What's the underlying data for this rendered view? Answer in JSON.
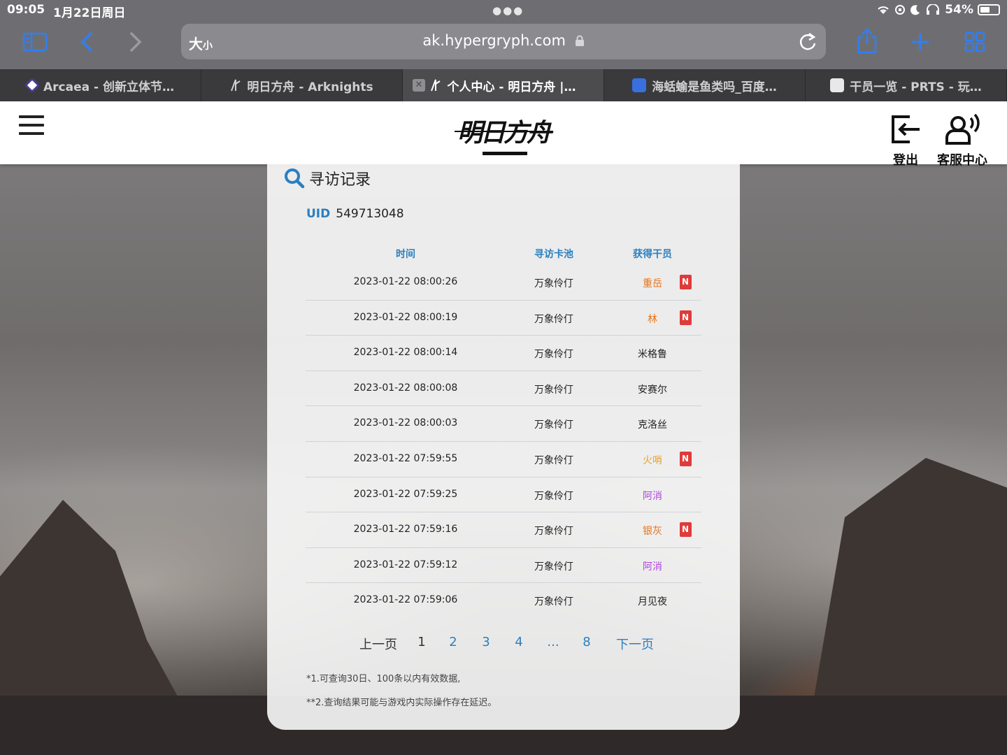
{
  "status_bar": {
    "time": "09:05",
    "date": "1月22日周日",
    "battery": "54%",
    "battery_level": 0.54
  },
  "browser": {
    "size_label": "大",
    "size_label_small": "小",
    "url": "ak.hypergryph.com",
    "tabs": [
      {
        "label": "Arcaea - 创新立体节…",
        "active": false
      },
      {
        "label": "明日方舟 - Arknights",
        "active": false
      },
      {
        "label": "个人中心 - 明日方舟 |…",
        "active": true
      },
      {
        "label": "海蛞蝓是鱼类吗_百度…",
        "active": false
      },
      {
        "label": "干员一览 - PRTS - 玩…",
        "active": false
      }
    ],
    "close_glyph": "✕"
  },
  "header": {
    "logo_text": "明日方舟",
    "logout_label": "登出",
    "support_label": "客服中心"
  },
  "main": {
    "title": "寻访记录",
    "uid_label": "UID",
    "uid_value": "549713048",
    "columns": {
      "time": "时间",
      "pool": "寻访卡池",
      "operator": "获得干员"
    },
    "rows": [
      {
        "time": "2023-01-22 08:00:26",
        "pool": "万象伶仃",
        "operator": "重岳",
        "color": "#e8731a",
        "new": "N"
      },
      {
        "time": "2023-01-22 08:00:19",
        "pool": "万象伶仃",
        "operator": "林",
        "color": "#e8731a",
        "new": "N"
      },
      {
        "time": "2023-01-22 08:00:14",
        "pool": "万象伶仃",
        "operator": "米格鲁",
        "color": "#222222",
        "new": ""
      },
      {
        "time": "2023-01-22 08:00:08",
        "pool": "万象伶仃",
        "operator": "安赛尔",
        "color": "#222222",
        "new": ""
      },
      {
        "time": "2023-01-22 08:00:03",
        "pool": "万象伶仃",
        "operator": "克洛丝",
        "color": "#222222",
        "new": ""
      },
      {
        "time": "2023-01-22 07:59:55",
        "pool": "万象伶仃",
        "operator": "火哨",
        "color": "#f0a020",
        "new": "N"
      },
      {
        "time": "2023-01-22 07:59:25",
        "pool": "万象伶仃",
        "operator": "阿消",
        "color": "#b044e0",
        "new": ""
      },
      {
        "time": "2023-01-22 07:59:16",
        "pool": "万象伶仃",
        "operator": "银灰",
        "color": "#e8731a",
        "new": "N"
      },
      {
        "time": "2023-01-22 07:59:12",
        "pool": "万象伶仃",
        "operator": "阿消",
        "color": "#b044e0",
        "new": ""
      },
      {
        "time": "2023-01-22 07:59:06",
        "pool": "万象伶仃",
        "operator": "月见夜",
        "color": "#222222",
        "new": ""
      }
    ],
    "pagination": {
      "prev": "上一页",
      "pages": [
        "1",
        "2",
        "3",
        "4",
        "...",
        "8"
      ],
      "current": "1",
      "next": "下一页"
    },
    "notes": [
      "*1.可查询30日、100条以内有效数据,",
      "**2.查询结果可能与游戏内实际操作存在延迟。"
    ]
  },
  "colors": {
    "accent": "#2a7fc0",
    "badge": "#e03a3a",
    "browser_blue": "#2f7ff5"
  }
}
